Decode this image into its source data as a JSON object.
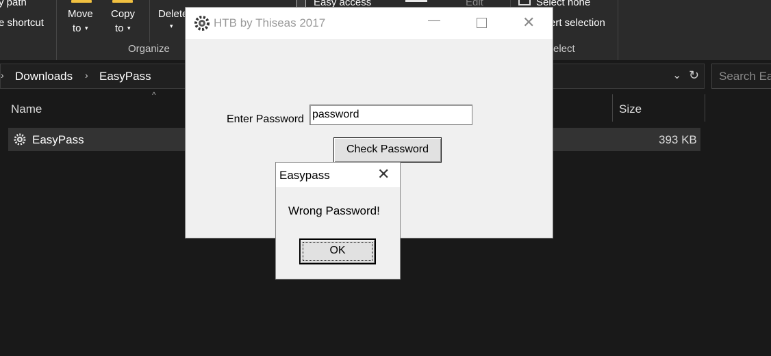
{
  "ribbon": {
    "copy_path_partial": "y path",
    "paste_shortcut_partial": "e shortcut",
    "move_to_label": "Move",
    "move_to_label2": "to",
    "copy_to_label": "Copy",
    "copy_to_label2": "to",
    "delete_partial": "Delete",
    "organize_group": "Organize",
    "easy_access_label": "Easy access",
    "edit_label": "Edit",
    "select_none_label": "Select none",
    "invert_selection_partial": "ert selection",
    "select_group_partial": "elect"
  },
  "address": {
    "crumbs": [
      "Downloads",
      "EasyPass"
    ],
    "search_placeholder": "Search Ea"
  },
  "columns": {
    "name": "Name",
    "size": "Size"
  },
  "files": [
    {
      "name": "EasyPass",
      "size": "393 KB",
      "icon": "gear-app-icon"
    }
  ],
  "htb_window": {
    "title": "HTB by Thiseas 2017",
    "password_label": "Enter Password",
    "password_value": "password",
    "check_button": "Check Password"
  },
  "popup": {
    "title": "Easypass",
    "message": "Wrong Password!",
    "ok_button": "OK"
  },
  "colors": {
    "explorer_bg": "#191919",
    "ribbon_bg": "#2b2b2b",
    "dialog_bg": "#f0f0f0",
    "selected_row": "#333333"
  }
}
